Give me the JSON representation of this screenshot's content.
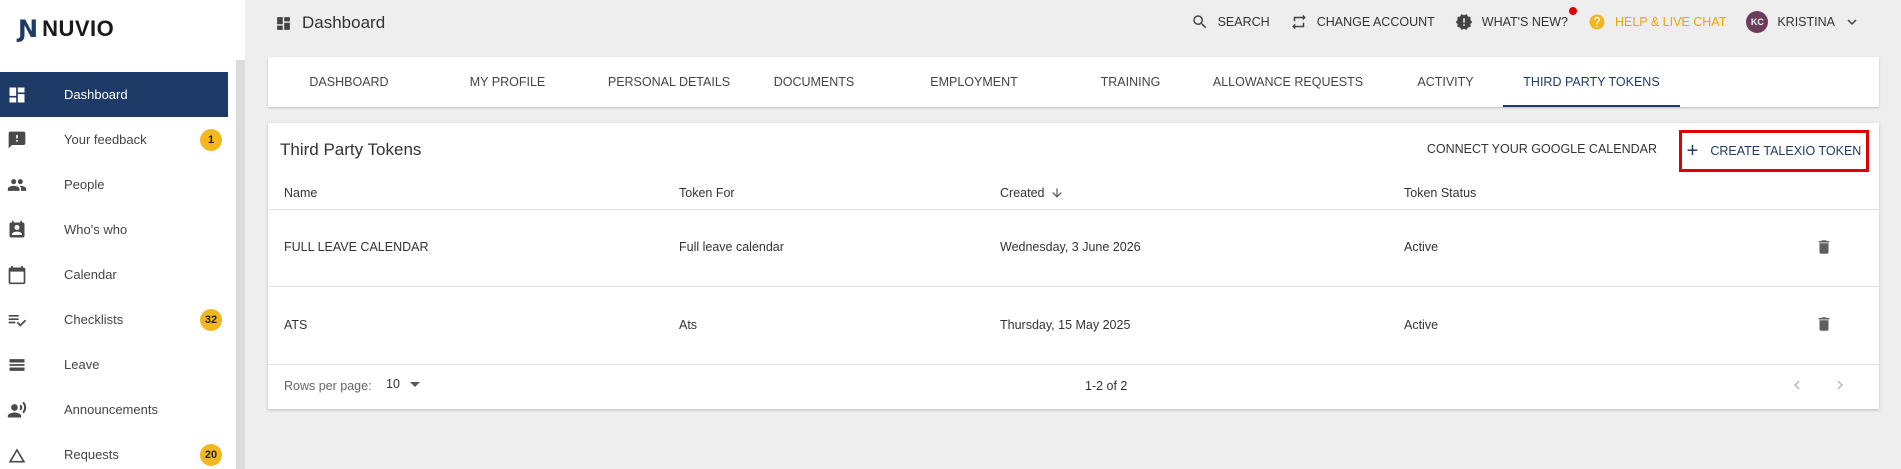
{
  "brand": {
    "logo_text": "NUVIO"
  },
  "sidebar": {
    "items": [
      {
        "label": "Dashboard",
        "icon": "dashboard-icon",
        "active": true,
        "badge": ""
      },
      {
        "label": "Your feedback",
        "icon": "feedback-icon",
        "active": false,
        "badge": "1"
      },
      {
        "label": "People",
        "icon": "people-icon",
        "active": false,
        "badge": ""
      },
      {
        "label": "Who's who",
        "icon": "contact-card-icon",
        "active": false,
        "badge": ""
      },
      {
        "label": "Calendar",
        "icon": "calendar-icon",
        "active": false,
        "badge": ""
      },
      {
        "label": "Checklists",
        "icon": "checklist-icon",
        "active": false,
        "badge": "32"
      },
      {
        "label": "Leave",
        "icon": "leave-icon",
        "active": false,
        "badge": ""
      },
      {
        "label": "Announcements",
        "icon": "announcements-icon",
        "active": false,
        "badge": ""
      },
      {
        "label": "Requests",
        "icon": "requests-icon",
        "active": false,
        "badge": "20"
      }
    ]
  },
  "header": {
    "title": "Dashboard",
    "search": "SEARCH",
    "change_account": "CHANGE ACCOUNT",
    "whats_new": "WHAT'S NEW?",
    "help": "HELP & LIVE CHAT",
    "user_initials": "KC",
    "user_name": "KRISTINA"
  },
  "tabs": [
    {
      "label": "DASHBOARD",
      "active": false
    },
    {
      "label": "MY PROFILE",
      "active": false
    },
    {
      "label": "PERSONAL DETAILS",
      "active": false
    },
    {
      "label": "DOCUMENTS",
      "active": false
    },
    {
      "label": "EMPLOYMENT",
      "active": false
    },
    {
      "label": "TRAINING",
      "active": false
    },
    {
      "label": "ALLOWANCE REQUESTS",
      "active": false
    },
    {
      "label": "ACTIVITY",
      "active": false
    },
    {
      "label": "THIRD PARTY TOKENS",
      "active": true
    }
  ],
  "card": {
    "title": "Third Party Tokens",
    "connect_google": "CONNECT YOUR GOOGLE CALENDAR",
    "create_token": "CREATE TALEXIO TOKEN",
    "columns": [
      "Name",
      "Token For",
      "Created",
      "Token Status"
    ],
    "rows": [
      {
        "name": "FULL LEAVE CALENDAR",
        "token_for": "Full leave calendar",
        "created": "Wednesday, 3 June 2026",
        "status": "Active"
      },
      {
        "name": "ATS",
        "token_for": "Ats",
        "created": "Thursday, 15 May 2025",
        "status": "Active"
      }
    ],
    "rows_per_page_label": "Rows per page:",
    "rows_per_page": "10",
    "range": "1-2 of 2"
  },
  "colors": {
    "primary": "#1e3a66",
    "badge": "#f3b81f",
    "help": "#f0a500",
    "highlight": "#e00000"
  }
}
